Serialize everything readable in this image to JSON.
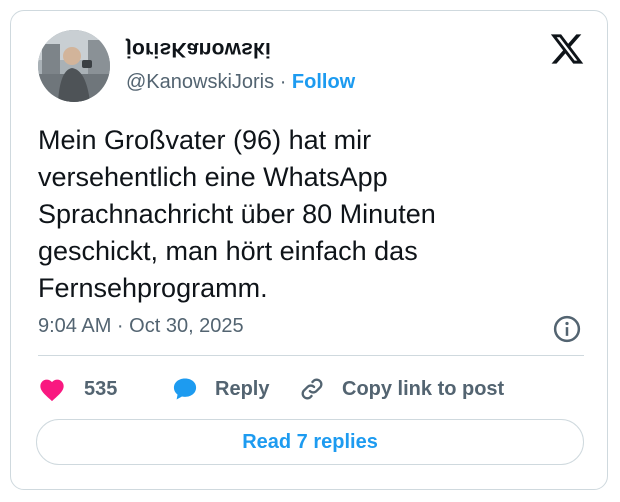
{
  "author": {
    "display_name": "jorisKanowski",
    "handle": "@KanowskiJoris",
    "separator": "·",
    "follow_label": "Follow",
    "avatar_icon": "profile-photo-icon"
  },
  "brand": {
    "logo_icon": "x-logo-icon"
  },
  "tweet": {
    "text_lines": [
      "Mein Großvater (96) hat mir",
      "versehentlich eine WhatsApp",
      "Sprachnachricht über 80 Minuten",
      "geschickt, man hört einfach das",
      "Fernsehprogramm."
    ],
    "timestamp": "9:04 AM · Oct 30, 2025",
    "info_icon": "info-icon"
  },
  "actions": {
    "like_count": "535",
    "like_icon": "heart-icon",
    "reply_label": "Reply",
    "reply_icon": "speech-bubble-icon",
    "copy_label": "Copy link to post",
    "copy_icon": "link-icon"
  },
  "footer": {
    "read_replies_label": "Read 7 replies"
  },
  "colors": {
    "accent": "#1d9bf0",
    "like": "#f91880",
    "text": "#0f1419",
    "muted": "#536471",
    "border": "#cfd9de"
  }
}
